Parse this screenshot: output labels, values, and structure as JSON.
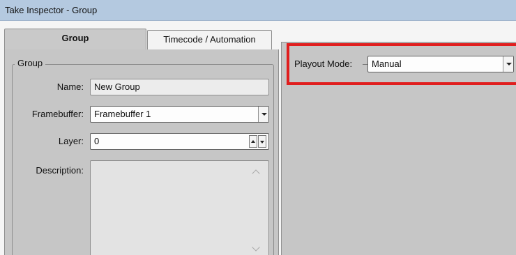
{
  "window": {
    "title": "Take Inspector - Group"
  },
  "tabs": [
    {
      "label": "Group",
      "active": true
    },
    {
      "label": "Timecode / Automation",
      "active": false
    }
  ],
  "group_section": {
    "legend": "Group",
    "name": {
      "label": "Name:",
      "value": "New Group"
    },
    "framebuffer": {
      "label": "Framebuffer:",
      "value": "Framebuffer 1"
    },
    "layer": {
      "label": "Layer:",
      "value": "0"
    },
    "description": {
      "label": "Description:",
      "value": ""
    }
  },
  "playout": {
    "label": "Playout Mode:",
    "value": "Manual"
  },
  "colors": {
    "titlebar": "#b4c9e0",
    "panel": "#c6c6c6",
    "highlight": "#e01e1e"
  },
  "icons": [
    "dropdown-arrow-icon",
    "spin-up-icon",
    "spin-down-icon",
    "scroll-up-icon",
    "scroll-down-icon"
  ]
}
